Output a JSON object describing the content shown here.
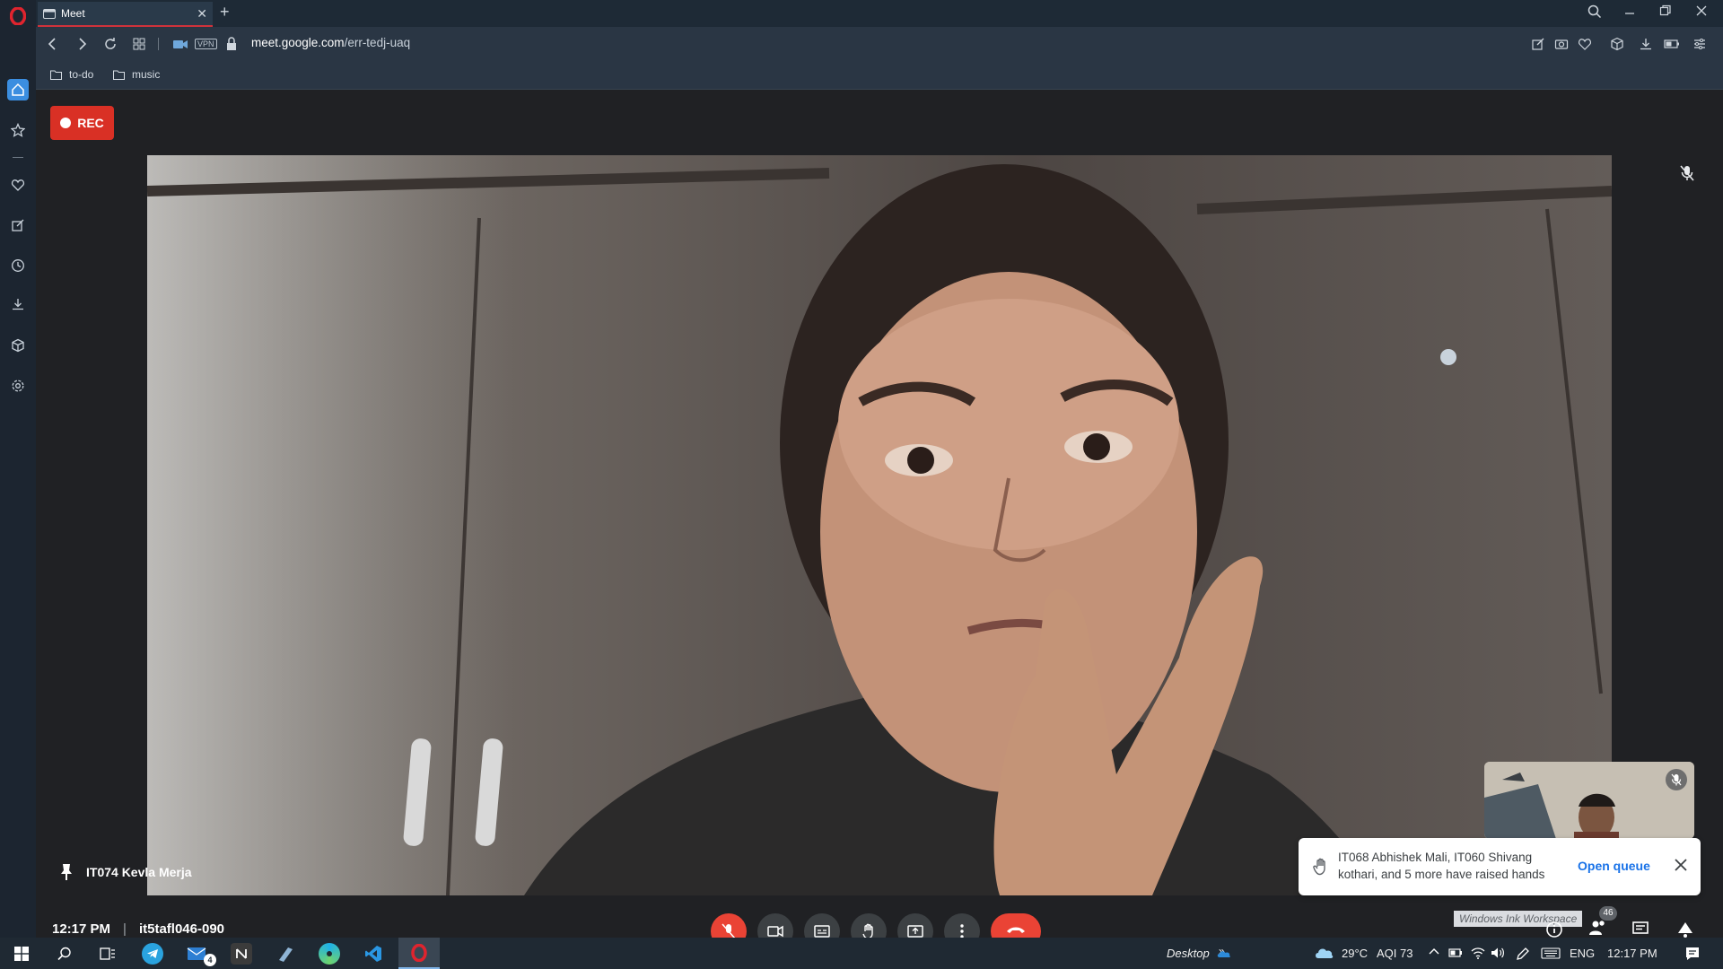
{
  "browser": {
    "tab_title": "Meet",
    "new_tab_label": "+",
    "tab_close": "✕",
    "vpn_label": "VPN",
    "url_domain": "meet.google.com",
    "url_path": "/err-tedj-uaq",
    "bookmarks": [
      "to-do",
      "music"
    ]
  },
  "meet": {
    "rec_label": "REC",
    "speaker_name": "IT074 Kevla Merja",
    "time": "12:17 PM",
    "meeting_code": "it5tafl046-090",
    "toast": {
      "message": "IT068 Abhishek Mali, IT060 Shivang kothari, and 5 more have raised hands",
      "action": "Open queue"
    },
    "people_count": "46",
    "ink_workspace": "Windows Ink Workspace"
  },
  "taskbar": {
    "mail_badge": "4",
    "desktop_label": "Desktop",
    "weather": "29°C",
    "aqi": "AQI 73",
    "language": "ENG",
    "clock": "12:17 PM"
  },
  "colors": {
    "rec_red": "#d93025",
    "end_call_red": "#ea4335",
    "link_blue": "#1a73e8",
    "opera_red": "#d0323b",
    "sidebar_active": "#3b8ee0"
  }
}
